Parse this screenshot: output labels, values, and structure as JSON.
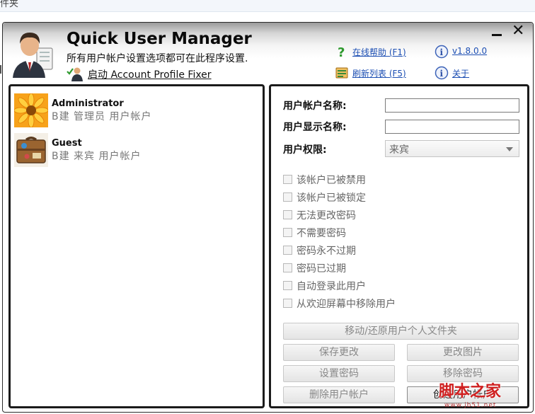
{
  "background": {
    "fragment": "件夹"
  },
  "window": {
    "title": "Quick User Manager",
    "subtitle": "所有用户帐户设置选项都可在此程序设置.",
    "launch_label": "启动 Account Profile Fixer",
    "links": {
      "help": "在线帮助 (F1)",
      "refresh": "刷新列表 (F5)",
      "version": "v1.8.0.0",
      "about": "关于"
    },
    "minimize_symbol": "—",
    "close_symbol": "✕"
  },
  "users": [
    {
      "name": "Administrator",
      "description": "B建 管理员 用户帐户",
      "avatar_icon": "flower-avatar-icon"
    },
    {
      "name": "Guest",
      "description": "B建 来宾 用户帐户",
      "avatar_icon": "suitcase-avatar-icon"
    }
  ],
  "form": {
    "account_name_label": "用户帐户名称:",
    "account_name_value": "",
    "display_name_label": "用户显示名称:",
    "display_name_value": "",
    "permission_label": "用户权限:",
    "permission_value": "来宾"
  },
  "options": [
    {
      "label": "该帐户已被禁用",
      "checked": false
    },
    {
      "label": "该帐户已被锁定",
      "checked": false
    },
    {
      "label": "无法更改密码",
      "checked": false
    },
    {
      "label": "不需要密码",
      "checked": false
    },
    {
      "label": "密码永不过期",
      "checked": false
    },
    {
      "label": "密码已过期",
      "checked": false
    },
    {
      "label": "自动登录此用户",
      "checked": false
    },
    {
      "label": "从欢迎屏幕中移除用户",
      "checked": false
    }
  ],
  "buttons": {
    "move_profile": "移动/还原用户个人文件夹",
    "save": "保存更改",
    "change_picture": "更改图片",
    "set_password": "设置密码",
    "remove_password": "移除密码",
    "delete_user": "删除用户帐户",
    "create_user": "创建用户帐户"
  },
  "watermark": {
    "text": "脚本之家",
    "url": "www.jb51.net"
  },
  "colors": {
    "link": "#1d4fb3",
    "border": "#1b1b1b",
    "disabled_text": "#888888",
    "watermark": "#cf1f1f"
  }
}
